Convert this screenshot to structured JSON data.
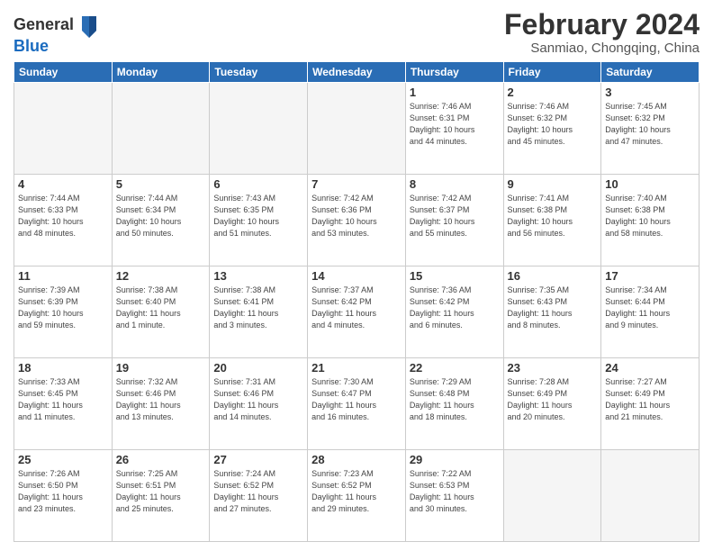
{
  "header": {
    "logo_line1": "General",
    "logo_line2": "Blue",
    "main_title": "February 2024",
    "sub_title": "Sanmiao, Chongqing, China"
  },
  "columns": [
    "Sunday",
    "Monday",
    "Tuesday",
    "Wednesday",
    "Thursday",
    "Friday",
    "Saturday"
  ],
  "weeks": [
    [
      {
        "day": "",
        "info": ""
      },
      {
        "day": "",
        "info": ""
      },
      {
        "day": "",
        "info": ""
      },
      {
        "day": "",
        "info": ""
      },
      {
        "day": "1",
        "info": "Sunrise: 7:46 AM\nSunset: 6:31 PM\nDaylight: 10 hours\nand 44 minutes."
      },
      {
        "day": "2",
        "info": "Sunrise: 7:46 AM\nSunset: 6:32 PM\nDaylight: 10 hours\nand 45 minutes."
      },
      {
        "day": "3",
        "info": "Sunrise: 7:45 AM\nSunset: 6:32 PM\nDaylight: 10 hours\nand 47 minutes."
      }
    ],
    [
      {
        "day": "4",
        "info": "Sunrise: 7:44 AM\nSunset: 6:33 PM\nDaylight: 10 hours\nand 48 minutes."
      },
      {
        "day": "5",
        "info": "Sunrise: 7:44 AM\nSunset: 6:34 PM\nDaylight: 10 hours\nand 50 minutes."
      },
      {
        "day": "6",
        "info": "Sunrise: 7:43 AM\nSunset: 6:35 PM\nDaylight: 10 hours\nand 51 minutes."
      },
      {
        "day": "7",
        "info": "Sunrise: 7:42 AM\nSunset: 6:36 PM\nDaylight: 10 hours\nand 53 minutes."
      },
      {
        "day": "8",
        "info": "Sunrise: 7:42 AM\nSunset: 6:37 PM\nDaylight: 10 hours\nand 55 minutes."
      },
      {
        "day": "9",
        "info": "Sunrise: 7:41 AM\nSunset: 6:38 PM\nDaylight: 10 hours\nand 56 minutes."
      },
      {
        "day": "10",
        "info": "Sunrise: 7:40 AM\nSunset: 6:38 PM\nDaylight: 10 hours\nand 58 minutes."
      }
    ],
    [
      {
        "day": "11",
        "info": "Sunrise: 7:39 AM\nSunset: 6:39 PM\nDaylight: 10 hours\nand 59 minutes."
      },
      {
        "day": "12",
        "info": "Sunrise: 7:38 AM\nSunset: 6:40 PM\nDaylight: 11 hours\nand 1 minute."
      },
      {
        "day": "13",
        "info": "Sunrise: 7:38 AM\nSunset: 6:41 PM\nDaylight: 11 hours\nand 3 minutes."
      },
      {
        "day": "14",
        "info": "Sunrise: 7:37 AM\nSunset: 6:42 PM\nDaylight: 11 hours\nand 4 minutes."
      },
      {
        "day": "15",
        "info": "Sunrise: 7:36 AM\nSunset: 6:42 PM\nDaylight: 11 hours\nand 6 minutes."
      },
      {
        "day": "16",
        "info": "Sunrise: 7:35 AM\nSunset: 6:43 PM\nDaylight: 11 hours\nand 8 minutes."
      },
      {
        "day": "17",
        "info": "Sunrise: 7:34 AM\nSunset: 6:44 PM\nDaylight: 11 hours\nand 9 minutes."
      }
    ],
    [
      {
        "day": "18",
        "info": "Sunrise: 7:33 AM\nSunset: 6:45 PM\nDaylight: 11 hours\nand 11 minutes."
      },
      {
        "day": "19",
        "info": "Sunrise: 7:32 AM\nSunset: 6:46 PM\nDaylight: 11 hours\nand 13 minutes."
      },
      {
        "day": "20",
        "info": "Sunrise: 7:31 AM\nSunset: 6:46 PM\nDaylight: 11 hours\nand 14 minutes."
      },
      {
        "day": "21",
        "info": "Sunrise: 7:30 AM\nSunset: 6:47 PM\nDaylight: 11 hours\nand 16 minutes."
      },
      {
        "day": "22",
        "info": "Sunrise: 7:29 AM\nSunset: 6:48 PM\nDaylight: 11 hours\nand 18 minutes."
      },
      {
        "day": "23",
        "info": "Sunrise: 7:28 AM\nSunset: 6:49 PM\nDaylight: 11 hours\nand 20 minutes."
      },
      {
        "day": "24",
        "info": "Sunrise: 7:27 AM\nSunset: 6:49 PM\nDaylight: 11 hours\nand 21 minutes."
      }
    ],
    [
      {
        "day": "25",
        "info": "Sunrise: 7:26 AM\nSunset: 6:50 PM\nDaylight: 11 hours\nand 23 minutes."
      },
      {
        "day": "26",
        "info": "Sunrise: 7:25 AM\nSunset: 6:51 PM\nDaylight: 11 hours\nand 25 minutes."
      },
      {
        "day": "27",
        "info": "Sunrise: 7:24 AM\nSunset: 6:52 PM\nDaylight: 11 hours\nand 27 minutes."
      },
      {
        "day": "28",
        "info": "Sunrise: 7:23 AM\nSunset: 6:52 PM\nDaylight: 11 hours\nand 29 minutes."
      },
      {
        "day": "29",
        "info": "Sunrise: 7:22 AM\nSunset: 6:53 PM\nDaylight: 11 hours\nand 30 minutes."
      },
      {
        "day": "",
        "info": ""
      },
      {
        "day": "",
        "info": ""
      }
    ]
  ]
}
